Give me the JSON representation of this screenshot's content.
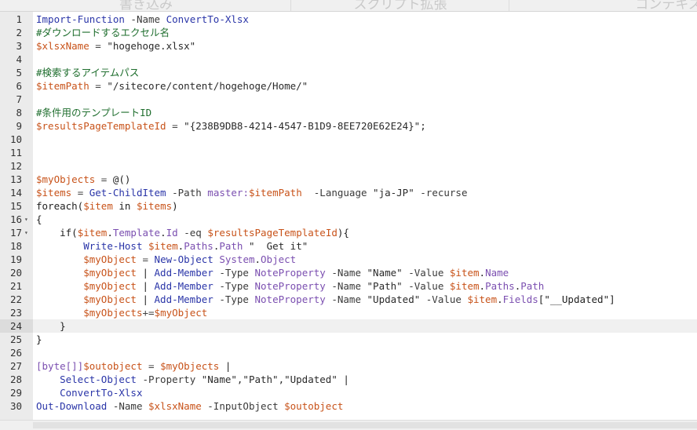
{
  "ribbon": {
    "tabs": [
      {
        "label": "書き込み"
      },
      {
        "label": "スクリプト拡張"
      },
      {
        "label": "コンテキスト"
      }
    ]
  },
  "editor": {
    "active_line": 24,
    "fold_lines": [
      16,
      17
    ],
    "lines": [
      {
        "n": "1",
        "tokens": [
          {
            "t": "cmd",
            "s": "Import-Function"
          },
          {
            "t": "plain",
            "s": " "
          },
          {
            "t": "param",
            "s": "-Name"
          },
          {
            "t": "plain",
            "s": " "
          },
          {
            "t": "cmd",
            "s": "ConvertTo-Xlsx"
          }
        ]
      },
      {
        "n": "2",
        "tokens": [
          {
            "t": "comment",
            "s": "#ダウンロードするエクセル名"
          }
        ]
      },
      {
        "n": "3",
        "tokens": [
          {
            "t": "var",
            "s": "$xlsxName"
          },
          {
            "t": "plain",
            "s": " "
          },
          {
            "t": "op",
            "s": "="
          },
          {
            "t": "plain",
            "s": " "
          },
          {
            "t": "str",
            "s": "\"hogehoge.xlsx\""
          }
        ]
      },
      {
        "n": "4",
        "tokens": []
      },
      {
        "n": "5",
        "tokens": [
          {
            "t": "comment",
            "s": "#検索するアイテムパス"
          }
        ]
      },
      {
        "n": "6",
        "tokens": [
          {
            "t": "var",
            "s": "$itemPath"
          },
          {
            "t": "plain",
            "s": " "
          },
          {
            "t": "op",
            "s": "="
          },
          {
            "t": "plain",
            "s": " "
          },
          {
            "t": "str",
            "s": "\"/sitecore/content/hogehoge/Home/\""
          }
        ]
      },
      {
        "n": "7",
        "tokens": []
      },
      {
        "n": "8",
        "tokens": [
          {
            "t": "comment",
            "s": "#条件用のテンプレートID"
          }
        ]
      },
      {
        "n": "9",
        "tokens": [
          {
            "t": "var",
            "s": "$resultsPageTemplateId"
          },
          {
            "t": "plain",
            "s": " "
          },
          {
            "t": "op",
            "s": "="
          },
          {
            "t": "plain",
            "s": " "
          },
          {
            "t": "str",
            "s": "\"{238B9DB8-4214-4547-B1D9-8EE720E62E24}\";"
          }
        ]
      },
      {
        "n": "10",
        "tokens": []
      },
      {
        "n": "11",
        "tokens": []
      },
      {
        "n": "12",
        "tokens": []
      },
      {
        "n": "13",
        "tokens": [
          {
            "t": "var",
            "s": "$myObjects"
          },
          {
            "t": "plain",
            "s": " "
          },
          {
            "t": "op",
            "s": "="
          },
          {
            "t": "plain",
            "s": " @()"
          }
        ]
      },
      {
        "n": "14",
        "tokens": [
          {
            "t": "var",
            "s": "$items"
          },
          {
            "t": "plain",
            "s": " "
          },
          {
            "t": "op",
            "s": "="
          },
          {
            "t": "plain",
            "s": " "
          },
          {
            "t": "cmd",
            "s": "Get-ChildItem"
          },
          {
            "t": "plain",
            "s": " "
          },
          {
            "t": "param",
            "s": "-Path"
          },
          {
            "t": "plain",
            "s": " "
          },
          {
            "t": "type",
            "s": "master:"
          },
          {
            "t": "var",
            "s": "$itemPath"
          },
          {
            "t": "plain",
            "s": "  "
          },
          {
            "t": "param",
            "s": "-Language"
          },
          {
            "t": "plain",
            "s": " "
          },
          {
            "t": "str",
            "s": "\"ja-JP\""
          },
          {
            "t": "plain",
            "s": " "
          },
          {
            "t": "param",
            "s": "-recurse"
          }
        ]
      },
      {
        "n": "15",
        "tokens": [
          {
            "t": "kw",
            "s": "foreach("
          },
          {
            "t": "var",
            "s": "$item"
          },
          {
            "t": "plain",
            "s": " in "
          },
          {
            "t": "var",
            "s": "$items"
          },
          {
            "t": "plain",
            "s": ")"
          }
        ]
      },
      {
        "n": "16",
        "tokens": [
          {
            "t": "plain",
            "s": "{"
          }
        ]
      },
      {
        "n": "17",
        "tokens": [
          {
            "t": "plain",
            "s": "    if("
          },
          {
            "t": "var",
            "s": "$item"
          },
          {
            "t": "plain",
            "s": "."
          },
          {
            "t": "type",
            "s": "Template"
          },
          {
            "t": "plain",
            "s": "."
          },
          {
            "t": "type",
            "s": "Id"
          },
          {
            "t": "plain",
            "s": " "
          },
          {
            "t": "param",
            "s": "-eq"
          },
          {
            "t": "plain",
            "s": " "
          },
          {
            "t": "var",
            "s": "$resultsPageTemplateId"
          },
          {
            "t": "plain",
            "s": "){"
          }
        ]
      },
      {
        "n": "18",
        "tokens": [
          {
            "t": "plain",
            "s": "        "
          },
          {
            "t": "cmd",
            "s": "Write-Host"
          },
          {
            "t": "plain",
            "s": " "
          },
          {
            "t": "var",
            "s": "$item"
          },
          {
            "t": "plain",
            "s": "."
          },
          {
            "t": "type",
            "s": "Paths"
          },
          {
            "t": "plain",
            "s": "."
          },
          {
            "t": "type",
            "s": "Path"
          },
          {
            "t": "plain",
            "s": " "
          },
          {
            "t": "str",
            "s": "\"  Get it\""
          }
        ]
      },
      {
        "n": "19",
        "tokens": [
          {
            "t": "plain",
            "s": "        "
          },
          {
            "t": "var",
            "s": "$myObject"
          },
          {
            "t": "plain",
            "s": " "
          },
          {
            "t": "op",
            "s": "="
          },
          {
            "t": "plain",
            "s": " "
          },
          {
            "t": "cmd",
            "s": "New-Object"
          },
          {
            "t": "plain",
            "s": " "
          },
          {
            "t": "type",
            "s": "System"
          },
          {
            "t": "plain",
            "s": "."
          },
          {
            "t": "type",
            "s": "Object"
          }
        ]
      },
      {
        "n": "20",
        "tokens": [
          {
            "t": "plain",
            "s": "        "
          },
          {
            "t": "var",
            "s": "$myObject"
          },
          {
            "t": "plain",
            "s": " | "
          },
          {
            "t": "cmd",
            "s": "Add-Member"
          },
          {
            "t": "plain",
            "s": " "
          },
          {
            "t": "param",
            "s": "-Type"
          },
          {
            "t": "plain",
            "s": " "
          },
          {
            "t": "type",
            "s": "NoteProperty"
          },
          {
            "t": "plain",
            "s": " "
          },
          {
            "t": "param",
            "s": "-Name"
          },
          {
            "t": "plain",
            "s": " "
          },
          {
            "t": "str",
            "s": "\"Name\""
          },
          {
            "t": "plain",
            "s": " "
          },
          {
            "t": "param",
            "s": "-Value"
          },
          {
            "t": "plain",
            "s": " "
          },
          {
            "t": "var",
            "s": "$item"
          },
          {
            "t": "plain",
            "s": "."
          },
          {
            "t": "type",
            "s": "Name"
          }
        ]
      },
      {
        "n": "21",
        "tokens": [
          {
            "t": "plain",
            "s": "        "
          },
          {
            "t": "var",
            "s": "$myObject"
          },
          {
            "t": "plain",
            "s": " | "
          },
          {
            "t": "cmd",
            "s": "Add-Member"
          },
          {
            "t": "plain",
            "s": " "
          },
          {
            "t": "param",
            "s": "-Type"
          },
          {
            "t": "plain",
            "s": " "
          },
          {
            "t": "type",
            "s": "NoteProperty"
          },
          {
            "t": "plain",
            "s": " "
          },
          {
            "t": "param",
            "s": "-Name"
          },
          {
            "t": "plain",
            "s": " "
          },
          {
            "t": "str",
            "s": "\"Path\""
          },
          {
            "t": "plain",
            "s": " "
          },
          {
            "t": "param",
            "s": "-Value"
          },
          {
            "t": "plain",
            "s": " "
          },
          {
            "t": "var",
            "s": "$item"
          },
          {
            "t": "plain",
            "s": "."
          },
          {
            "t": "type",
            "s": "Paths"
          },
          {
            "t": "plain",
            "s": "."
          },
          {
            "t": "type",
            "s": "Path"
          }
        ]
      },
      {
        "n": "22",
        "tokens": [
          {
            "t": "plain",
            "s": "        "
          },
          {
            "t": "var",
            "s": "$myObject"
          },
          {
            "t": "plain",
            "s": " | "
          },
          {
            "t": "cmd",
            "s": "Add-Member"
          },
          {
            "t": "plain",
            "s": " "
          },
          {
            "t": "param",
            "s": "-Type"
          },
          {
            "t": "plain",
            "s": " "
          },
          {
            "t": "type",
            "s": "NoteProperty"
          },
          {
            "t": "plain",
            "s": " "
          },
          {
            "t": "param",
            "s": "-Name"
          },
          {
            "t": "plain",
            "s": " "
          },
          {
            "t": "str",
            "s": "\"Updated\""
          },
          {
            "t": "plain",
            "s": " "
          },
          {
            "t": "param",
            "s": "-Value"
          },
          {
            "t": "plain",
            "s": " "
          },
          {
            "t": "var",
            "s": "$item"
          },
          {
            "t": "plain",
            "s": "."
          },
          {
            "t": "type",
            "s": "Fields"
          },
          {
            "t": "plain",
            "s": "[\"__Updated\"]"
          }
        ]
      },
      {
        "n": "23",
        "tokens": [
          {
            "t": "plain",
            "s": "        "
          },
          {
            "t": "var",
            "s": "$myObjects"
          },
          {
            "t": "op",
            "s": "+="
          },
          {
            "t": "var",
            "s": "$myObject"
          }
        ]
      },
      {
        "n": "24",
        "tokens": [
          {
            "t": "plain",
            "s": "    }"
          }
        ]
      },
      {
        "n": "25",
        "tokens": [
          {
            "t": "plain",
            "s": "}"
          }
        ]
      },
      {
        "n": "26",
        "tokens": []
      },
      {
        "n": "27",
        "tokens": [
          {
            "t": "type",
            "s": "[byte[]]"
          },
          {
            "t": "var",
            "s": "$outobject"
          },
          {
            "t": "plain",
            "s": " "
          },
          {
            "t": "op",
            "s": "="
          },
          {
            "t": "plain",
            "s": " "
          },
          {
            "t": "var",
            "s": "$myObjects"
          },
          {
            "t": "plain",
            "s": " |"
          }
        ]
      },
      {
        "n": "28",
        "tokens": [
          {
            "t": "plain",
            "s": "    "
          },
          {
            "t": "cmd",
            "s": "Select-Object"
          },
          {
            "t": "plain",
            "s": " "
          },
          {
            "t": "param",
            "s": "-Property"
          },
          {
            "t": "plain",
            "s": " "
          },
          {
            "t": "str",
            "s": "\"Name\",\"Path\",\"Updated\""
          },
          {
            "t": "plain",
            "s": " |"
          }
        ]
      },
      {
        "n": "29",
        "tokens": [
          {
            "t": "plain",
            "s": "    "
          },
          {
            "t": "cmd",
            "s": "ConvertTo-Xlsx"
          }
        ]
      },
      {
        "n": "30",
        "tokens": [
          {
            "t": "cmd",
            "s": "Out-Download"
          },
          {
            "t": "plain",
            "s": " "
          },
          {
            "t": "param",
            "s": "-Name"
          },
          {
            "t": "plain",
            "s": " "
          },
          {
            "t": "var",
            "s": "$xlsxName"
          },
          {
            "t": "plain",
            "s": " "
          },
          {
            "t": "param",
            "s": "-InputObject"
          },
          {
            "t": "plain",
            "s": " "
          },
          {
            "t": "var",
            "s": "$outobject"
          }
        ]
      }
    ]
  }
}
